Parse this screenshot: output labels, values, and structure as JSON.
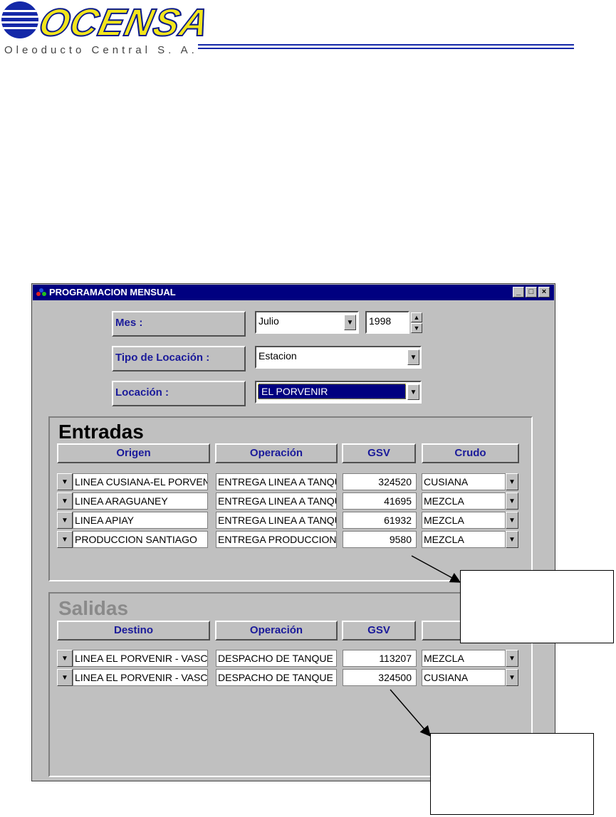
{
  "logo": {
    "name": "OCENSA",
    "subtitle": "Oleoducto Central S. A.",
    "colors": {
      "blue": "#1428a8",
      "yellow": "#f2e51b"
    }
  },
  "window": {
    "title": "PROGRAMACION MENSUAL",
    "title_icon": "app-icon",
    "buttons": {
      "minimize": "_",
      "maximize": "□",
      "close": "×"
    }
  },
  "form": {
    "mes_label": "Mes :",
    "mes_value": "Julio",
    "year_value": "1998",
    "tipo_label": "Tipo de Locación :",
    "tipo_value": "Estacion",
    "locacion_label": "Locación :",
    "locacion_value": "EL PORVENIR"
  },
  "entradas": {
    "title": "Entradas",
    "headers": [
      "Origen",
      "Operación",
      "GSV",
      "Crudo"
    ],
    "rows": [
      {
        "origen": "LINEA  CUSIANA-EL PORVENIR",
        "operacion": "ENTREGA LINEA A TANQUE",
        "gsv": "324520",
        "crudo": "CUSIANA"
      },
      {
        "origen": "LINEA  ARAGUANEY",
        "operacion": "ENTREGA LINEA A TANQUE",
        "gsv": "41695",
        "crudo": "MEZCLA"
      },
      {
        "origen": "LINEA  APIAY",
        "operacion": "ENTREGA LINEA A TANQUE",
        "gsv": "61932",
        "crudo": "MEZCLA"
      },
      {
        "origen": "PRODUCCION  SANTIAGO",
        "operacion": "ENTREGA PRODUCCION",
        "gsv": "9580",
        "crudo": "MEZCLA"
      }
    ]
  },
  "salidas": {
    "title": "Salidas",
    "headers": [
      "Destino",
      "Operación",
      "GSV",
      "C"
    ],
    "rows": [
      {
        "destino": "LINEA  EL PORVENIR - VASCONIA",
        "operacion": "DESPACHO DE TANQUE",
        "gsv": "113207",
        "crudo": "MEZCLA"
      },
      {
        "destino": "LINEA  EL PORVENIR - VASCONIA",
        "operacion": "DESPACHO DE TANQUE",
        "gsv": "324500",
        "crudo": "CUSIANA"
      }
    ]
  },
  "icons": {
    "dropdown": "▼",
    "spin_up": "▲",
    "spin_down": "▼"
  }
}
